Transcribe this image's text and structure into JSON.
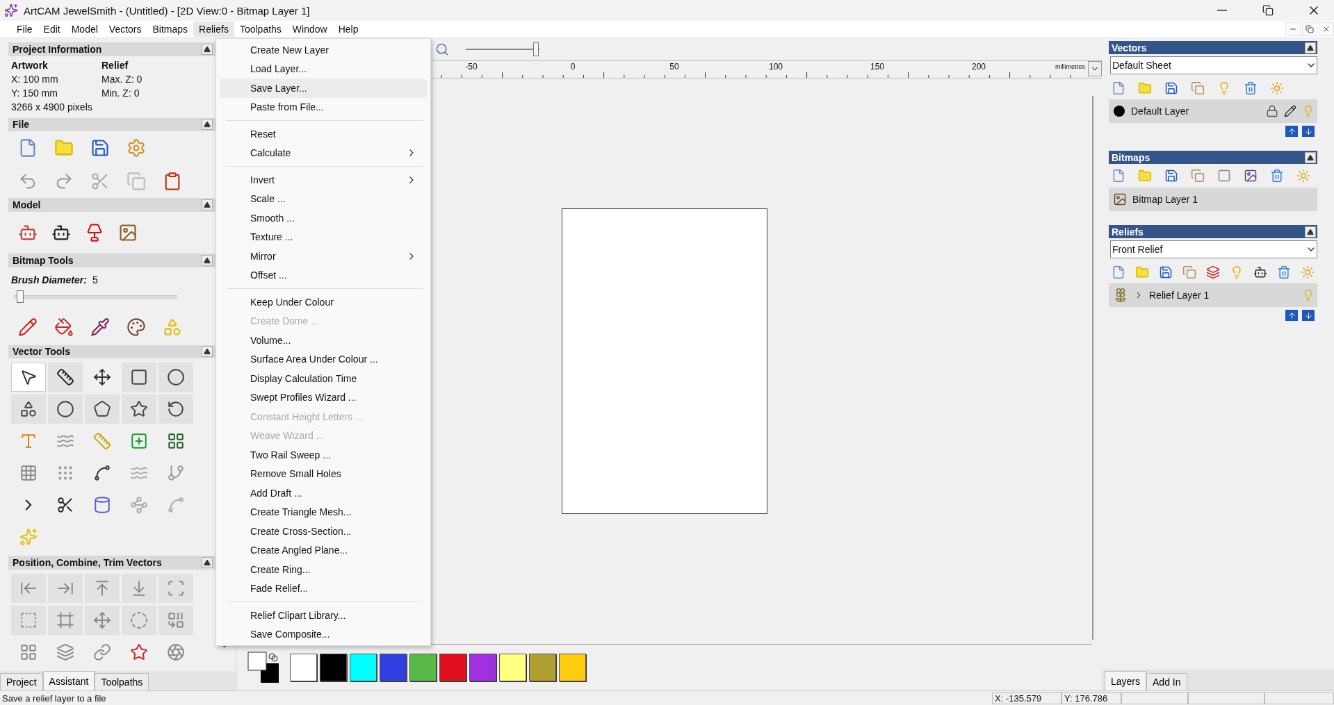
{
  "window": {
    "title": "ArtCAM JewelSmith - (Untitled) - [2D View:0 - Bitmap Layer 1]"
  },
  "menu_bar": [
    {
      "label": "File",
      "selected": false
    },
    {
      "label": "Edit",
      "selected": false
    },
    {
      "label": "Model",
      "selected": false
    },
    {
      "label": "Vectors",
      "selected": false
    },
    {
      "label": "Bitmaps",
      "selected": false
    },
    {
      "label": "Reliefs",
      "selected": true
    },
    {
      "label": "Toolpaths",
      "selected": false
    },
    {
      "label": "Window",
      "selected": false
    },
    {
      "label": "Help",
      "selected": false
    }
  ],
  "reliefs_menu": {
    "groups": [
      {
        "items": [
          {
            "label": "Create New Layer",
            "selected": false,
            "disabled": false,
            "submenu": false
          },
          {
            "label": "Load Layer...",
            "selected": false,
            "disabled": false,
            "submenu": false
          },
          {
            "label": "Save Layer...",
            "selected": true,
            "disabled": false,
            "submenu": false
          },
          {
            "label": "Paste from File...",
            "selected": false,
            "disabled": false,
            "submenu": false
          }
        ]
      },
      {
        "items": [
          {
            "label": "Reset",
            "selected": false,
            "disabled": false,
            "submenu": false
          },
          {
            "label": "Calculate",
            "selected": false,
            "disabled": false,
            "submenu": true
          }
        ]
      },
      {
        "items": [
          {
            "label": "Invert",
            "selected": false,
            "disabled": false,
            "submenu": true
          },
          {
            "label": "Scale  ...",
            "selected": false,
            "disabled": false,
            "submenu": false
          },
          {
            "label": "Smooth ...",
            "selected": false,
            "disabled": false,
            "submenu": false
          },
          {
            "label": "Texture ...",
            "selected": false,
            "disabled": false,
            "submenu": false
          },
          {
            "label": "Mirror",
            "selected": false,
            "disabled": false,
            "submenu": true
          },
          {
            "label": "Offset ...",
            "selected": false,
            "disabled": false,
            "submenu": false
          }
        ]
      },
      {
        "items": [
          {
            "label": "Keep Under Colour",
            "selected": false,
            "disabled": false,
            "submenu": false
          },
          {
            "label": "Create Dome ...",
            "selected": false,
            "disabled": true,
            "submenu": false
          },
          {
            "label": "Volume...",
            "selected": false,
            "disabled": false,
            "submenu": false
          },
          {
            "label": "Surface Area Under Colour ...",
            "selected": false,
            "disabled": false,
            "submenu": false
          },
          {
            "label": "Display Calculation Time",
            "selected": false,
            "disabled": false,
            "submenu": false
          },
          {
            "label": "Swept Profiles Wizard ...",
            "selected": false,
            "disabled": false,
            "submenu": false
          },
          {
            "label": "Constant Height Letters ...",
            "selected": false,
            "disabled": true,
            "submenu": false
          },
          {
            "label": "Weave Wizard ...",
            "selected": false,
            "disabled": true,
            "submenu": false
          },
          {
            "label": "Two Rail Sweep ...",
            "selected": false,
            "disabled": false,
            "submenu": false
          },
          {
            "label": "Remove Small Holes",
            "selected": false,
            "disabled": false,
            "submenu": false
          },
          {
            "label": "Add Draft ...",
            "selected": false,
            "disabled": false,
            "submenu": false
          },
          {
            "label": "Create Triangle Mesh...",
            "selected": false,
            "disabled": false,
            "submenu": false
          },
          {
            "label": "Create Cross-Section...",
            "selected": false,
            "disabled": false,
            "submenu": false
          },
          {
            "label": "Create Angled Plane...",
            "selected": false,
            "disabled": false,
            "submenu": false
          },
          {
            "label": "Create Ring...",
            "selected": false,
            "disabled": false,
            "submenu": false
          },
          {
            "label": "Fade Relief...",
            "selected": false,
            "disabled": false,
            "submenu": false
          }
        ]
      },
      {
        "items": [
          {
            "label": "Relief Clipart Library...",
            "selected": false,
            "disabled": false,
            "submenu": false
          },
          {
            "label": "Save Composite...",
            "selected": false,
            "disabled": false,
            "submenu": false
          }
        ]
      }
    ]
  },
  "left_panel": {
    "project_information": {
      "title": "Project Information",
      "artwork": {
        "heading": "Artwork",
        "lines": [
          "X: 100 mm",
          "Y: 150 mm"
        ]
      },
      "relief": {
        "heading": "Relief",
        "lines": [
          "Max. Z: 0",
          "Min. Z: 0"
        ]
      },
      "pixels": "3266 x 4900 pixels"
    },
    "file": {
      "title": "File"
    },
    "model": {
      "title": "Model"
    },
    "bitmap_tools": {
      "title": "Bitmap Tools",
      "brush_label": "Brush Diameter:",
      "brush_value": "5",
      "level": 0.04
    },
    "vector_tools": {
      "title": "Vector Tools"
    },
    "position_tools": {
      "title": "Position, Combine, Trim Vectors"
    },
    "tabs": [
      {
        "label": "Project",
        "selected": false
      },
      {
        "label": "Assistant",
        "selected": true
      },
      {
        "label": "Toolpaths",
        "selected": false
      }
    ]
  },
  "zoom_slider": {
    "level": 0.95
  },
  "ruler": {
    "labels": [
      "-50",
      "0",
      "50",
      "100",
      "150",
      "200"
    ],
    "unit": "millimetres"
  },
  "palette": [
    {
      "color": "#ffffff"
    },
    {
      "color": "#000000"
    },
    {
      "color": "#00ffff"
    },
    {
      "color": "#3040e0"
    },
    {
      "color": "#58b848"
    },
    {
      "color": "#e01020"
    },
    {
      "color": "#a030e0"
    },
    {
      "color": "#ffff80"
    },
    {
      "color": "#b0a030"
    },
    {
      "color": "#ffcc10"
    }
  ],
  "right_panel": {
    "vectors": {
      "title": "Vectors",
      "sheet": "Default Sheet",
      "layers": [
        {
          "name": "Default Layer",
          "color": "#000000"
        }
      ]
    },
    "bitmaps": {
      "title": "Bitmaps",
      "layers": [
        {
          "name": "Bitmap Layer 1"
        }
      ]
    },
    "reliefs": {
      "title": "Reliefs",
      "selector": "Front Relief",
      "layers": [
        {
          "name": "Relief Layer 1"
        }
      ]
    },
    "tabs": [
      {
        "label": "Layers",
        "selected": true
      },
      {
        "label": "Add In",
        "selected": false
      }
    ]
  },
  "status_bar": {
    "message": "Save a relief layer to a file",
    "x": "X: -135.579",
    "y": "Y: 176.786"
  }
}
